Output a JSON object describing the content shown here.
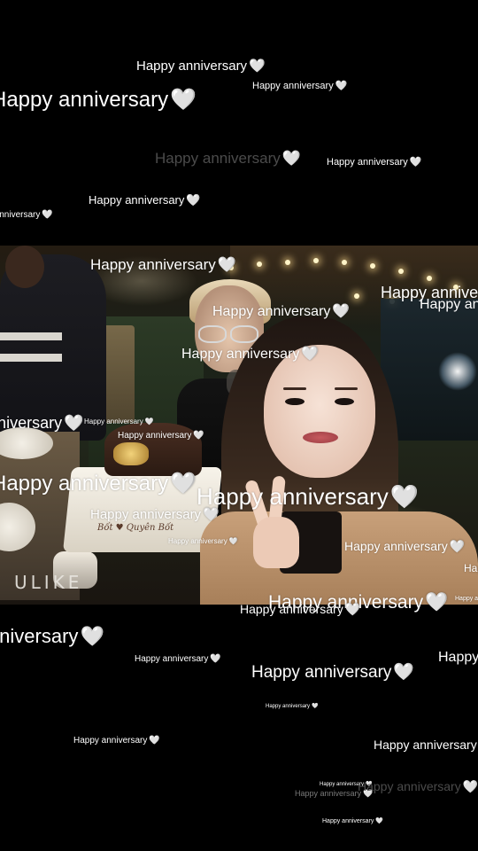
{
  "caption": {
    "text": "Happy anniversary",
    "heart": "🤍",
    "heart_icon": "white-heart-icon"
  },
  "photo": {
    "brand": "ULIKE",
    "cake_writing": "Bốt ♥ Quyên Bốt"
  },
  "colors": {
    "background": "#000000",
    "caption_primary": "#ffffff",
    "caption_dim": "#4b4b4b"
  }
}
